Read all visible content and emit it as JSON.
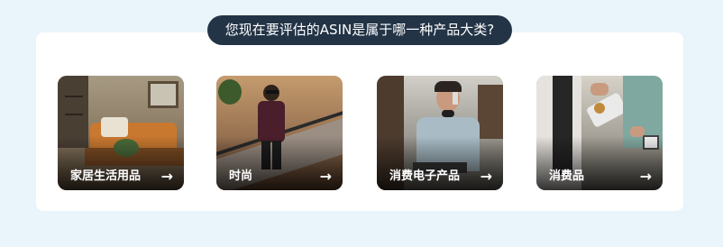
{
  "question": "您现在要评估的ASIN是属于哪一种产品大类?",
  "categories": [
    {
      "label": "家居生活用品",
      "arrow": "→"
    },
    {
      "label": "时尚",
      "arrow": "→"
    },
    {
      "label": "消费电子产品",
      "arrow": "→"
    },
    {
      "label": "消费品",
      "arrow": "→"
    }
  ],
  "colors": {
    "page_background": "#eaf4fb",
    "question_pill": "#233446",
    "panel": "#ffffff"
  }
}
